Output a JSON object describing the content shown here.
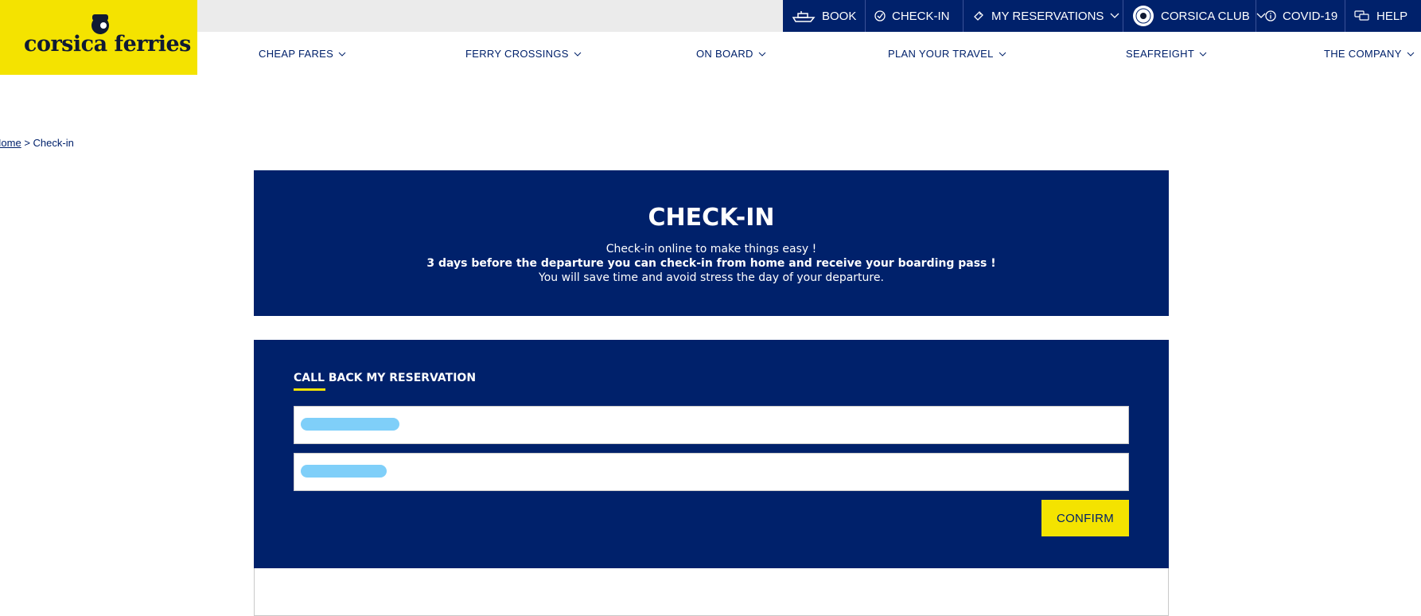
{
  "brand": {
    "logo_text": "corsica ferries",
    "logo_color": "#f4e300",
    "primary_color": "#00216b"
  },
  "utility_nav": [
    {
      "label": "BOOK",
      "icon": "ship-icon"
    },
    {
      "label": "CHECK-IN",
      "icon": "check-circle-icon"
    },
    {
      "label": "MY RESERVATIONS",
      "icon": "ticket-icon",
      "has_dropdown": true
    },
    {
      "label": "CORSICA CLUB",
      "icon": "club-badge-icon",
      "has_dropdown": true
    },
    {
      "label": "COVID-19",
      "icon": "info-circle-icon"
    },
    {
      "label": "HELP",
      "icon": "chat-bubbles-icon"
    }
  ],
  "main_nav": [
    {
      "label": "CHEAP FARES"
    },
    {
      "label": "FERRY CROSSINGS"
    },
    {
      "label": "ON BOARD"
    },
    {
      "label": "PLAN YOUR TRAVEL"
    },
    {
      "label": "SEAFREIGHT"
    },
    {
      "label": "THE COMPANY"
    }
  ],
  "breadcrumb": {
    "home": "Home",
    "separator": ">",
    "current": "Check-in"
  },
  "hero": {
    "title": "CHECK-IN",
    "line1": "Check-in online to make things easy !",
    "line2": "3 days before the departure you can check-in from home and receive your boarding pass !",
    "line3": "You will save time and avoid stress the day of your departure."
  },
  "form": {
    "title": "CALL BACK MY RESERVATION",
    "confirm_label": "CONFIRM"
  }
}
